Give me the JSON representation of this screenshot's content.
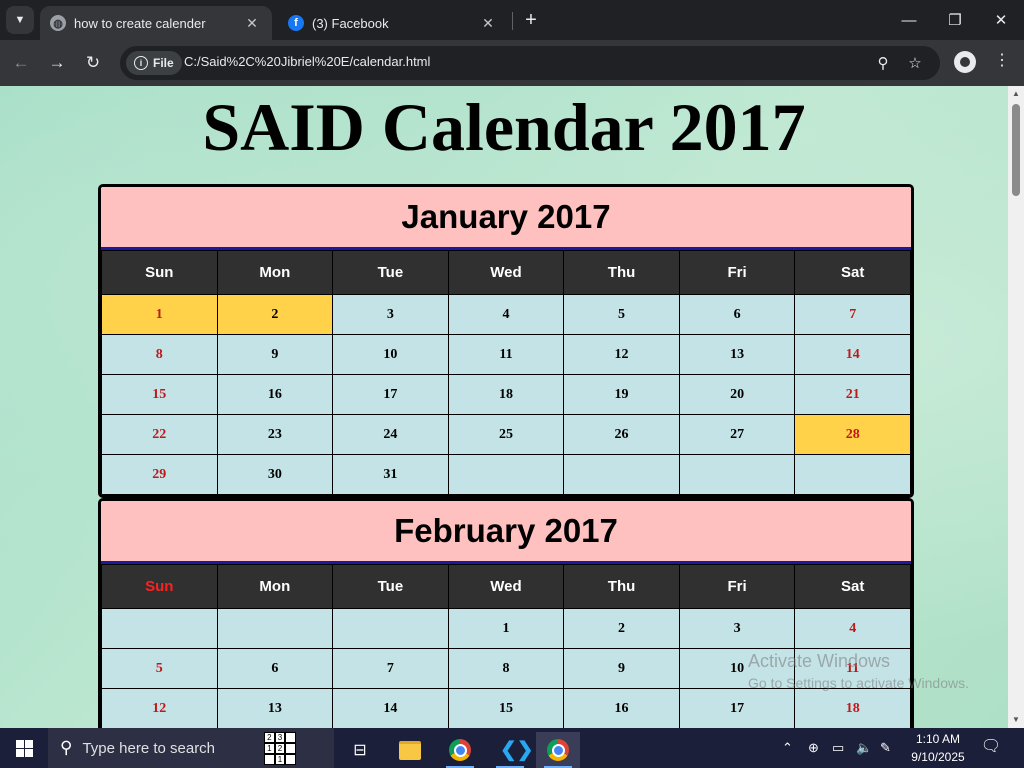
{
  "browser": {
    "tabs": [
      {
        "title": "how to create calender",
        "active": true
      },
      {
        "title": "(3) Facebook",
        "active": false
      }
    ],
    "url": "C:/Said%2C%20Jibriel%20E/calendar.html",
    "site_chip_label": "File"
  },
  "page": {
    "title": "SAID Calendar 2017",
    "weekdays": [
      "Sun",
      "Mon",
      "Tue",
      "Wed",
      "Thu",
      "Fri",
      "Sat"
    ],
    "months": [
      {
        "name": "January 2017",
        "weeks": [
          [
            "1",
            "2",
            "3",
            "4",
            "5",
            "6",
            "7"
          ],
          [
            "8",
            "9",
            "10",
            "11",
            "12",
            "13",
            "14"
          ],
          [
            "15",
            "16",
            "17",
            "18",
            "19",
            "20",
            "21"
          ],
          [
            "22",
            "23",
            "24",
            "25",
            "26",
            "27",
            "28"
          ],
          [
            "29",
            "30",
            "31",
            "",
            "",
            "",
            ""
          ]
        ],
        "highlighted_days": [
          "1",
          "2",
          "28"
        ],
        "sunday_header_red": false
      },
      {
        "name": "February 2017",
        "weeks": [
          [
            "",
            "",
            "",
            "1",
            "2",
            "3",
            "4"
          ],
          [
            "5",
            "6",
            "7",
            "8",
            "9",
            "10",
            "11"
          ],
          [
            "12",
            "13",
            "14",
            "15",
            "16",
            "17",
            "18"
          ]
        ],
        "highlighted_days": [],
        "sunday_header_red": true
      }
    ]
  },
  "watermark": {
    "line1": "Activate Windows",
    "line2": "Go to Settings to activate Windows."
  },
  "taskbar": {
    "search_placeholder": "Type here to search",
    "time": "1:10 AM",
    "date": "9/10/2025"
  },
  "colors": {
    "month_header_bg": "#ffc0c0",
    "cell_bg": "#c4e3e6",
    "highlight": "#ffd24a",
    "weekend_text": "#c01818"
  }
}
